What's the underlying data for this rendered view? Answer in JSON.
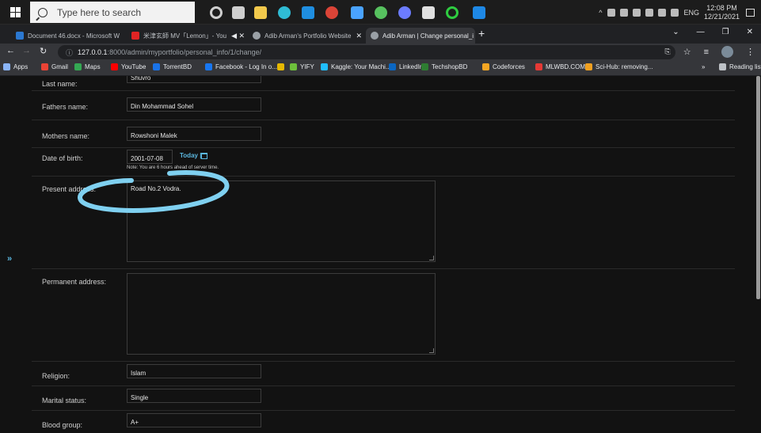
{
  "taskbar": {
    "search_placeholder": "Type here to search",
    "apps": [
      {
        "icon": "task-view-icon",
        "color": "#cfcfcf"
      },
      {
        "icon": "task-list-icon",
        "color": "#cfcfcf"
      },
      {
        "icon": "file-explorer-icon",
        "color": "#f2c94c"
      },
      {
        "icon": "edge-icon",
        "color": "#2fbcd4"
      },
      {
        "icon": "mail-icon",
        "color": "#1f8ee0"
      },
      {
        "icon": "chrome-icon",
        "color": "#db4437"
      },
      {
        "icon": "check-app-icon",
        "color": "#4aa3ff"
      },
      {
        "icon": "xbox-icon",
        "color": "#57c15f"
      },
      {
        "icon": "browser-icon",
        "color": "#6c7cff"
      },
      {
        "icon": "epic-games-icon",
        "color": "#e0e0e0"
      },
      {
        "icon": "circle-app-icon",
        "color": "#2ecc40"
      },
      {
        "icon": "vscode-icon",
        "color": "#1e88e5"
      }
    ],
    "tray_language": "ENG",
    "clock_time": "12:08 PM",
    "clock_date": "12/21/2021"
  },
  "tabs": [
    {
      "label": "Document 46.docx - Microsoft W",
      "favicon_color": "#2b78d1"
    },
    {
      "label": "米津玄師 MV「Lemon」- You",
      "favicon_color": "#e02424"
    },
    {
      "label": "Adib Arman's Portfolio Website",
      "favicon_color": "#9aa0a6"
    },
    {
      "label": "Adib Arman | Change personal_i",
      "favicon_color": "#9aa0a6"
    }
  ],
  "address": {
    "host": "127.0.0.1",
    "path": ":8000/admin/myportfolio/personal_info/1/change/"
  },
  "bookmarks": [
    {
      "label": "Apps",
      "color": "#8ab4f8"
    },
    {
      "label": "Gmail",
      "color": "#ea4335"
    },
    {
      "label": "Maps",
      "color": "#34a853"
    },
    {
      "label": "YouTube",
      "color": "#ff0000"
    },
    {
      "label": "TorrentBD",
      "color": "#1a73e8"
    },
    {
      "label": "Facebook - Log In o...",
      "color": "#1877f2"
    },
    {
      "label": "",
      "color": "#e6b800"
    },
    {
      "label": "YIFY",
      "color": "#6dbf3b"
    },
    {
      "label": "Kaggle: Your Machi...",
      "color": "#20beff"
    },
    {
      "label": "LinkedIn",
      "color": "#0a66c2"
    },
    {
      "label": "TechshopBD",
      "color": "#2e7d32"
    },
    {
      "label": "Codeforces",
      "color": "#f5a623"
    },
    {
      "label": "MLWBD.COM",
      "color": "#e53935"
    },
    {
      "label": "Sci-Hub: removing...",
      "color": "#f0a020"
    },
    {
      "label": "Reading list",
      "color": "#bdc1c6"
    }
  ],
  "form": {
    "last_name_label": "Last name:",
    "last_name_value": "Shuvro",
    "fathers_name_label": "Fathers name:",
    "fathers_name_value": "Din Mohammad Sohel",
    "mothers_name_label": "Mothers name:",
    "mothers_name_value": "Rowshoni Malek",
    "dob_label": "Date of birth:",
    "dob_value": "2001-07-08",
    "today_link": "Today |",
    "dob_note": "Note: You are 6 hours ahead of server time.",
    "present_address_label": "Present address:",
    "present_address_value": "Road No.2 Vodra.",
    "permanent_address_label": "Permanent address:",
    "permanent_address_value": "",
    "religion_label": "Religion:",
    "religion_value": "Islam",
    "marital_status_label": "Marital status:",
    "marital_status_value": "Single",
    "blood_group_label": "Blood group:",
    "blood_group_value": "A+"
  },
  "sidebar_toggle": "»",
  "colors": {
    "annotation": "#7fd0f0",
    "link": "#5bb8e0"
  }
}
